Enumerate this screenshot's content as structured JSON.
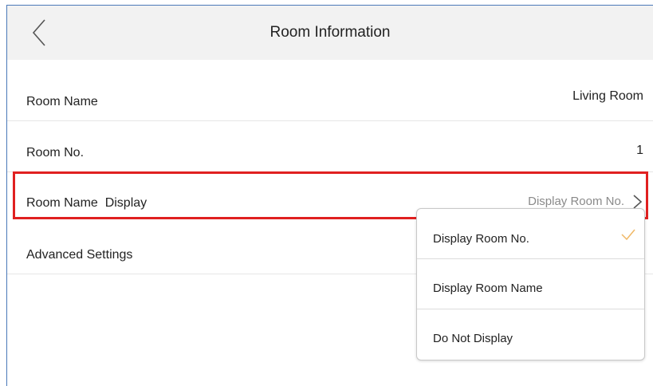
{
  "header": {
    "title": "Room Information",
    "back_icon": "chevron-left-icon"
  },
  "rows": {
    "room_name": {
      "label": "Room Name",
      "value": "Living Room"
    },
    "room_no": {
      "label": "Room No.",
      "value": "1"
    },
    "room_name_display": {
      "label": "Room Name  Display",
      "value": "Display Room No.",
      "icon": "chevron-right-icon"
    },
    "advanced_settings": {
      "label": "Advanced Settings"
    }
  },
  "dropdown": {
    "options": [
      {
        "label": "Display Room No.",
        "selected": true
      },
      {
        "label": "Display Room Name",
        "selected": false
      },
      {
        "label": "Do Not Display",
        "selected": false
      }
    ],
    "check_icon": "check-icon"
  },
  "colors": {
    "header_bg": "#f2f2f2",
    "highlight": "#e02020",
    "check": "#f0b866",
    "muted_text": "#8a8a8a"
  }
}
